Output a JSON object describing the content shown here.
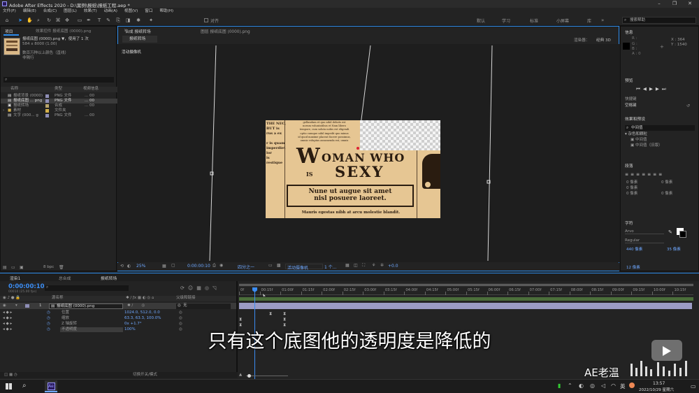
{
  "window": {
    "title": "Adobe After Effects 2020 - D:\\案例\\报纸\\报纸工程.aep *"
  },
  "menu": [
    "文件(F)",
    "编辑(E)",
    "合成(C)",
    "图层(L)",
    "效果(T)",
    "动画(A)",
    "视图(V)",
    "窗口",
    "帮助(H)"
  ],
  "toolbar": {
    "align_label": "对齐",
    "workspaces": [
      "默认",
      "学习",
      "标准",
      "小屏幕",
      "库"
    ],
    "search_placeholder": "搜索帮助"
  },
  "project": {
    "tab": "项目",
    "effects_tab": "效果控件 报纸底图 (0000).png",
    "file_name": "报纸底图 (0000).png ▼，使用了 1 次",
    "file_info": "584 x 8000 (1.00)",
    "color_info": "数百万种以上颜色（直线）",
    "frames": "非隔行",
    "columns": [
      "名称",
      "类型",
      "视频信息"
    ],
    "items": [
      {
        "name": "报纸背景 (0000)",
        "type": "PNG 文件",
        "info": "... 00"
      },
      {
        "name": "报纸底图 ... png",
        "type": "PNG 文件",
        "info": "... 00"
      },
      {
        "name": "报纸转场",
        "type": "合成",
        "info": "... 00"
      },
      {
        "name": "素材",
        "type": "文件夹",
        "info": ""
      },
      {
        "name": "文字 (000... g",
        "type": "PNG 文件",
        "info": "... 00"
      }
    ],
    "bpc": "8 bpc"
  },
  "composition": {
    "tab": "合成 报纸转场",
    "layer_tab": "图层 报纸底图 (0000).png",
    "subtab": "报纸转场",
    "renderer": "渲染器：",
    "renderer_value": "经典 3D",
    "camera_label": "活动摄像机",
    "zoom": "25%",
    "timecode": "0:00:00:10",
    "resolution": "四分之一",
    "view": "活动摄像机",
    "views": "1 个...",
    "exposure": "+0.0"
  },
  "newspaper": {
    "top_left": "THE NEC,\nBUT is\nrus a ex\n \nr is quam\nimperdiet\nlor\nis\nrestique",
    "top_center": "gellandum et quo nihil deluits est\nnorum voluntatibus et Nam libero\ntempore, cum soluta nobis est eligendi\noptio cumque nihil impedit quo minus\nid quod maxime placeat facere possimus,\nomnis voluptas assumenda est, omnis",
    "headline_w": "W",
    "headline_1": "OMAN WHO",
    "headline_is": "IS",
    "headline_2": "SEXY",
    "box_line1": "Nune ut augue sit amet",
    "box_line2": "nisl posuere laoreet.",
    "footer": "Mauris egestas nibh at arcu molestie blandit."
  },
  "right_panels": {
    "info_title": "信息",
    "info_x": "X : 364",
    "info_y": "Y : 1540",
    "info_rgba": [
      "R :",
      "G :",
      "B :",
      "A : 0"
    ],
    "preview_title": "预览",
    "shortcut_label": "快捷键",
    "shortcut_value": "空格键",
    "effects_title": "效果和预设",
    "effects_search": "中间值",
    "effects_group": "杂色和颗粒",
    "effects_items": [
      "中间值",
      "中间值（旧版）"
    ],
    "paragraph_title": "段落",
    "paragraph_values": [
      "0 像素",
      "0 像素",
      "0 像素",
      "0 像素",
      "0 像素"
    ],
    "char_title": "字符",
    "font": "Arvo",
    "font_style": "Regular",
    "font_size": "440 像素",
    "leading": "35 像素",
    "tracking": "12 像素"
  },
  "timeline": {
    "tabs": [
      "渲染1",
      "总合成",
      "报纸转场"
    ],
    "timecode": "0:00:00:10",
    "fps": "00010 (25.00 fps)",
    "columns": [
      "源名称",
      "父级和链接"
    ],
    "layer": {
      "number": "1",
      "name": "报纸底图 (0000).png",
      "parent": "无"
    },
    "properties": [
      {
        "name": "位置",
        "value": "1024.0, 512.0, 0.0"
      },
      {
        "name": "缩放",
        "value": "63.3, 63.3, 100.0%"
      },
      {
        "name": "Z 轴旋转",
        "value": "0x +1.7°"
      },
      {
        "name": "不透明度",
        "value": "100%"
      }
    ],
    "ruler": [
      "0f",
      "00:15f",
      "01:00f",
      "01:15f",
      "02:00f",
      "02:15f",
      "03:00f",
      "03:15f",
      "04:00f",
      "04:15f",
      "05:00f",
      "05:15f",
      "06:00f",
      "06:15f",
      "07:00f",
      "07:15f",
      "08:00f",
      "08:15f",
      "09:00f",
      "09:15f",
      "10:00f",
      "10:15f"
    ],
    "footer": "切换开关/模式"
  },
  "subtitle": "只有这个底图他的透明度是降低的",
  "watermark": "AE老温",
  "taskbar": {
    "time": "13:57",
    "date": "2022/10/29 星期六",
    "lang": "英"
  },
  "colors": {
    "accent": "#2d8ceb",
    "ae_purple": "#9999ff",
    "paper": "#e6c693",
    "clip": "#9b9bc4"
  }
}
